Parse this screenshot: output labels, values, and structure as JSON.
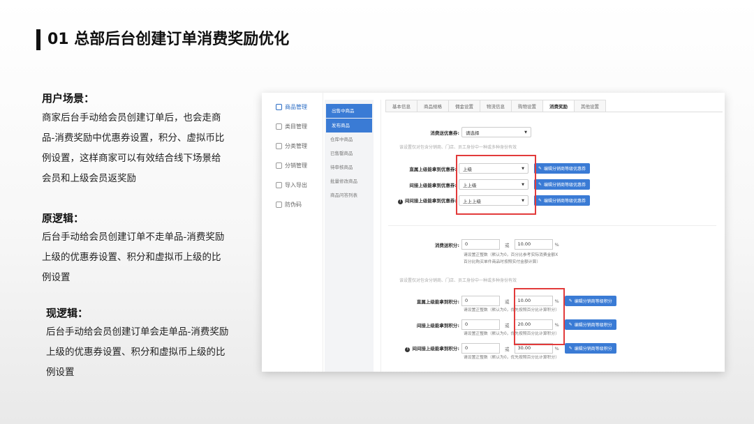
{
  "slide": {
    "title": "01 总部后台创建订单消费奖励优化"
  },
  "scene": {
    "heading": "用户场景：",
    "body": "商家后台手动给会员创建订单后，也会走商品-消费奖励中优惠券设置，积分、虚拟币比例设置，这样商家可以有效结合线下场景给会员和上级会员返奖励"
  },
  "old_logic": {
    "heading": "原逻辑：",
    "body": "后台手动给会员创建订单不走单品-消费奖励上级的优惠券设置、积分和虚拟币上级的比例设置"
  },
  "new_logic": {
    "heading": "现逻辑：",
    "body": "后台手动给会员创建订单会走单品-消费奖励上级的优惠券设置、积分和虚拟币上级的比例设置"
  },
  "screenshot": {
    "nav": [
      {
        "label": "商品管理",
        "icon": "goods-icon"
      },
      {
        "label": "类目管理",
        "icon": "category-icon"
      },
      {
        "label": "分类管理",
        "icon": "classify-icon"
      },
      {
        "label": "分销管理",
        "icon": "distribution-icon"
      },
      {
        "label": "导入导出",
        "icon": "import-export-icon"
      },
      {
        "label": "防伪码",
        "icon": "anti-fake-icon"
      }
    ],
    "subnav": [
      "出售中商品",
      "发布商品",
      "仓库中商品",
      "已售罄商品",
      "待审核商品",
      "批量修改商品",
      "商品问答列表"
    ],
    "tabs": [
      "基本信息",
      "商品规格",
      "佣金设置",
      "物流信息",
      "购物设置",
      "消费奖励",
      "其他设置"
    ],
    "coupon": {
      "label": "消费送优惠券:",
      "value": "请选择",
      "hint": "该设置仅对包含分销商、门店、员工身份中一种或多种身份有效",
      "rows": [
        {
          "label": "直属上级能拿到优惠券:",
          "value": "上级"
        },
        {
          "label": "间接上级能拿到优惠券:",
          "value": "上上级"
        },
        {
          "label": "间间接上级能拿到优惠券:",
          "value": "上上上级"
        }
      ],
      "button": "编辑分销商等级优惠券"
    },
    "points": {
      "label": "消费送积分:",
      "value": "0",
      "or": "或",
      "percent": "10.00",
      "unit": "%",
      "note": "请设置正整数（默认为0，百分比参考实际消费金额X百分比购买单件商品时按照实付金额计算）",
      "hint": "该设置仅对包含分销商、门店、员工身份中一种或多种身份有效",
      "rows": [
        {
          "label": "直属上级能拿到积分:",
          "value": "0",
          "percent": "10.00"
        },
        {
          "label": "间接上级能拿到积分:",
          "value": "0",
          "percent": "20.00"
        },
        {
          "label": "间间接上级能拿到积分:",
          "value": "0",
          "percent": "30.00"
        }
      ],
      "row_note": "请设置正整数（默认为0，优先按照百分比计算积分）",
      "button": "编辑分销商等级积分"
    }
  }
}
